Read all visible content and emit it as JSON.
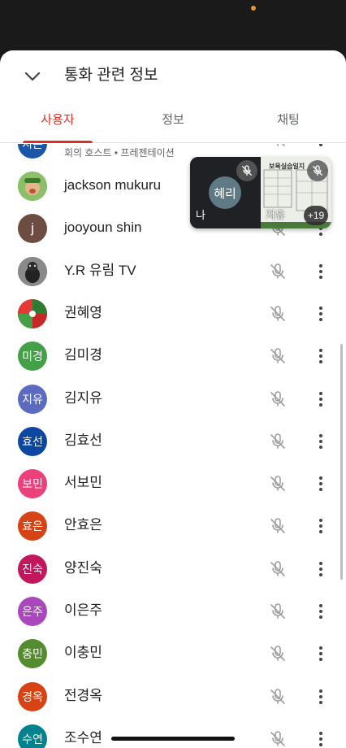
{
  "header": {
    "title": "통화 관련 정보"
  },
  "tabs": [
    {
      "label": "사용자",
      "active": true
    },
    {
      "label": "정보",
      "active": false
    },
    {
      "label": "채팅",
      "active": false
    }
  ],
  "partial_row": {
    "avatar": "지은",
    "sub": "회의 호스트 • 프레젠테이션",
    "color": "#1a57a8"
  },
  "participants": [
    {
      "name": "jackson mukuru",
      "avatar": "",
      "color": "#7fae5a",
      "type": "photo"
    },
    {
      "name": "jooyoun shin",
      "avatar": "j",
      "color": "#6d4c41",
      "type": "letter"
    },
    {
      "name": "Y.R 유림 TV",
      "avatar": "",
      "color": "#777777",
      "type": "photo"
    },
    {
      "name": "권혜영",
      "avatar": "",
      "color": "#c62828",
      "type": "photo"
    },
    {
      "name": "김미경",
      "avatar": "미경",
      "color": "#43a047"
    },
    {
      "name": "김지유",
      "avatar": "지유",
      "color": "#5c6bc0"
    },
    {
      "name": "김효선",
      "avatar": "효선",
      "color": "#0d47a1"
    },
    {
      "name": "서보민",
      "avatar": "보민",
      "color": "#ec407a"
    },
    {
      "name": "안효은",
      "avatar": "효은",
      "color": "#d84315"
    },
    {
      "name": "양진숙",
      "avatar": "진숙",
      "color": "#c2185b"
    },
    {
      "name": "이은주",
      "avatar": "은주",
      "color": "#ab47bc"
    },
    {
      "name": "이충민",
      "avatar": "충민",
      "color": "#558b2f"
    },
    {
      "name": "전경옥",
      "avatar": "경옥",
      "color": "#d84315"
    },
    {
      "name": "조수연",
      "avatar": "수연",
      "color": "#00838f"
    }
  ],
  "pip": {
    "me_avatar": "혜리",
    "me_label": "나",
    "other_label": "지유",
    "doc_title": "보육실습일지",
    "more_count": "+19"
  }
}
